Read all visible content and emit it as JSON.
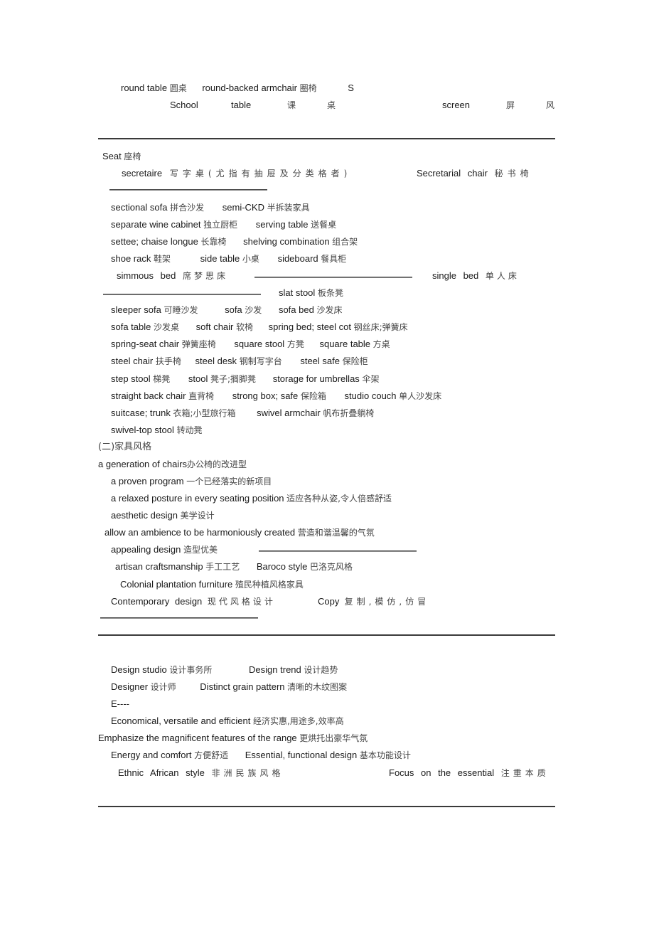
{
  "rows": {
    "r1": {
      "a_en": "round table",
      "a_zh": "圆桌",
      "b_en": "round-backed armchair",
      "b_zh": "圈椅",
      "c": "S"
    },
    "r2": {
      "a_en": "School",
      "a_en2": "table",
      "a_zh1": "课",
      "a_zh2": "桌",
      "b_en": "screen",
      "b_zh1": "屏",
      "b_zh2": "风"
    },
    "seat": {
      "en": "Seat",
      "zh": "座椅"
    },
    "r3": {
      "a_en": "secretaire",
      "a_zh": "写字桌(尤指有抽屉及分类格者)",
      "b_en": "Secretarial chair",
      "b_zh": "秘书椅"
    },
    "r4": {
      "a_en": "sectional sofa",
      "a_zh": "拼合沙发",
      "b_en": "semi-CKD",
      "b_zh": "半拆装家具"
    },
    "r5": {
      "a_en": "separate wine cabinet",
      "a_zh": "独立厨柜",
      "b_en": "serving table",
      "b_zh": "送餐桌"
    },
    "r6": {
      "a_en": "settee; chaise longue",
      "a_zh": "长靠椅",
      "b_en": "shelving combination",
      "b_zh": "组合架"
    },
    "r7": {
      "a_en": "shoe rack",
      "a_zh": "鞋架",
      "b_en": "side table",
      "b_zh": "小桌",
      "c_en": "sideboard",
      "c_zh": "餐具柜"
    },
    "r8": {
      "a_en": "simmous bed",
      "a_zh": "席梦思床",
      "b_en": "single bed",
      "b_zh": "单人床"
    },
    "r9": {
      "a_en": "slat stool",
      "a_zh": "板条凳"
    },
    "r10": {
      "a_en": "sleeper sofa",
      "a_zh": "可睡沙发",
      "b_en": "sofa",
      "b_zh": "沙发",
      "c_en": "sofa bed",
      "c_zh": "沙发床"
    },
    "r11": {
      "a_en": "sofa table",
      "a_zh": "沙发桌",
      "b_en": "soft chair",
      "b_zh": "软椅",
      "c_en": "spring bed; steel cot",
      "c_zh": "钢丝床;弹簧床"
    },
    "r12": {
      "a_en": "spring-seat chair",
      "a_zh": "弹簧座椅",
      "b_en": "square stool",
      "b_zh": "方凳",
      "c_en": "square table",
      "c_zh": "方桌"
    },
    "r13": {
      "a_en": "steel chair",
      "a_zh": "扶手椅",
      "b_en": "steel desk",
      "b_zh": "钢制写字台",
      "c_en": "steel safe",
      "c_zh": "保险柜"
    },
    "r14": {
      "a_en": "step stool",
      "a_zh": "梯凳",
      "b_en": "stool",
      "b_zh": "凳子;搁脚凳",
      "c_en": "storage for umbrellas",
      "c_zh": "伞架"
    },
    "r15": {
      "a_en": "straight back chair",
      "a_zh": "直背椅",
      "b_en": "strong box; safe",
      "b_zh": "保险箱",
      "c_en": "studio couch",
      "c_zh": "单人沙发床"
    },
    "r16": {
      "a_en": "suitcase; trunk",
      "a_zh": "衣箱;小型旅行箱",
      "b_en": "swivel armchair",
      "b_zh": "帆布折叠躺椅"
    },
    "r17": {
      "a_en": "swivel-top stool",
      "a_zh": "转动凳"
    },
    "section": "(二)家具风格",
    "r18": {
      "a_en": "a generation of chairs",
      "a_zh": "办公椅的改进型"
    },
    "r19": {
      "a_en": "a proven program",
      "a_zh": "一个已经落实的新项目"
    },
    "r20": {
      "a_en": "a relaxed posture in every seating position",
      "a_zh": "适应各种从姿,令人倍感舒适"
    },
    "r21": {
      "a_en": "aesthetic design",
      "a_zh": "美学设计"
    },
    "r22": {
      "a_en": "allow an ambience to be harmoniously created",
      "a_zh": "营造和谐温馨的气氛"
    },
    "r23": {
      "a_en": "appealing design",
      "a_zh": "造型优美"
    },
    "r24": {
      "a_en": "artisan craftsmanship",
      "a_zh": "手工工艺",
      "b_en": "Baroco style",
      "b_zh": "巴洛克风格"
    },
    "r25": {
      "a_en": "Colonial plantation furniture",
      "a_zh": "殖民种植风格家具"
    },
    "r26": {
      "a_en": "Contemporary design",
      "a_zh": "现代风格设计",
      "b_en": "Copy",
      "b_zh": "复制,模仿,仿冒"
    },
    "r27": {
      "a_en": "Design studio",
      "a_zh": "设计事务所",
      "b_en": "Design trend",
      "b_zh": "设计趋势"
    },
    "r28": {
      "a_en": "Designer",
      "a_zh": "设计师",
      "b_en": "Distinct grain pattern",
      "b_zh": "清晰的木纹图案"
    },
    "r29": {
      "a_en": "E----"
    },
    "r30": {
      "a_en": "Economical, versatile and efficient",
      "a_zh": "经济实惠,用途多,效率高"
    },
    "r31": {
      "a_en": "Emphasize the magnificent features of the range",
      "a_zh": "更烘托出豪华气氛"
    },
    "r32": {
      "a_en": "Energy and comfort",
      "a_zh": "方便舒适",
      "b_en": "Essential, functional design",
      "b_zh": "基本功能设计"
    },
    "r33": {
      "a_en": "Ethnic African style",
      "a_zh": "非洲民族风格",
      "b_en": "Focus on the essential",
      "b_zh": "注重本质"
    }
  }
}
